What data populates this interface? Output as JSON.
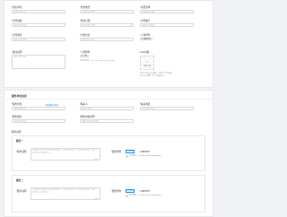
{
  "top": {
    "row1": [
      {
        "label": "招标单位",
        "placeholder": "请选择招标单位"
      },
      {
        "label": "签约类型",
        "placeholder": "请选择签约类型"
      },
      {
        "label": "项目名称",
        "placeholder": "请选择项目名称"
      }
    ],
    "row2": [
      {
        "label": "合同总额",
        "placeholder": "请输入合同总额"
      },
      {
        "label": "签约日期",
        "placeholder": "请选择签约日期"
      },
      {
        "label": "合同编号",
        "placeholder": "请输入合同编号"
      }
    ],
    "row3": [
      {
        "label": "合同类型",
        "placeholder": "请输入合同类型"
      },
      {
        "label": "付款方式",
        "placeholder": "请选择付款方式"
      },
      {
        "label": "上传附件",
        "button": "选择文件"
      }
    ],
    "row4": {
      "remark_label": "备注说明",
      "remark_placeholder": "请输入备注说明",
      "upload_label": "上传附件",
      "upload_button": "上传",
      "upload_types": "支持扩展名：.doc .docx .pdf .xls .jpg .png",
      "image_label": "LOGO图",
      "image_upload_text": "点击上传",
      "image_hint_1": "支持上传jpg/png格式，图片尺寸不超过",
      "image_hint_2": "800*800像素，大小不超过2M"
    }
  },
  "bottom": {
    "section_title": "服务单位信息",
    "row1": [
      {
        "label": "服务单位",
        "placeholder": "请选择服务单位",
        "link": "新增服务单位"
      },
      {
        "label": "联系人",
        "placeholder": "请输入联系人"
      },
      {
        "label": "联系电话",
        "placeholder": "请选择联系电话"
      }
    ],
    "row2": [
      {
        "label": "服务地址",
        "placeholder": "请输入服务地址"
      },
      {
        "label": "服务内容说明",
        "placeholder": "请输入服务内容说明"
      }
    ],
    "sub_title": "服务说明",
    "blocks": [
      {
        "title": "服务一",
        "text_label": "服务说明",
        "text_placeholder_1": "请描述服务的相关内容及服务要求，说明服务的时间、地点及服务范围，便于",
        "text_placeholder_2": "服务单位了解和执行。",
        "count": "0/500",
        "file_label": "服务附件",
        "file_button": "附件",
        "file_button_2": "上传服务附件",
        "file_hint": "支持格式：doc/docx/pdf/xls/jpg/png/zip"
      },
      {
        "title": "服务二",
        "text_label": "服务说明",
        "text_placeholder_1": "请描述服务的相关内容及服务要求，说明服务的时间、地点及服务范围，便于",
        "text_placeholder_2": "服务单位了解和执行。",
        "count": "0/500",
        "file_label": "服务附件",
        "file_button": "附件",
        "file_button_2": "上传服务附件",
        "file_hint": "支持格式：doc/docx/pdf/xls/jpg/png/zip"
      }
    ]
  }
}
